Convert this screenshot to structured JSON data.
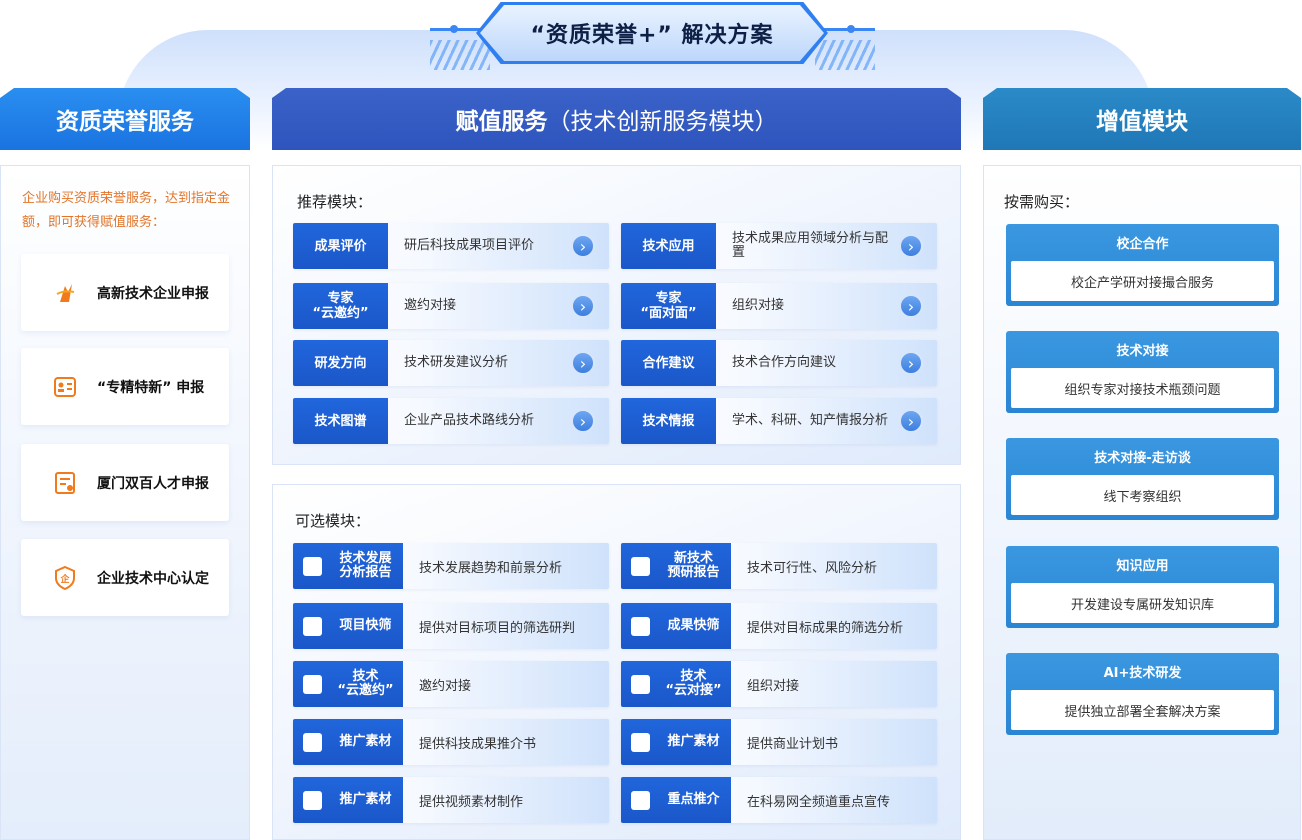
{
  "title": "“资质荣誉+” 解决方案",
  "columns": {
    "left": {
      "header": "资质荣誉服务",
      "intro": "企业购买资质荣誉服务，达到指定金额，即可获得赋值服务：",
      "items": [
        {
          "label": "高新技术企业申报",
          "icon": "torch-icon"
        },
        {
          "label": "“专精特新” 申报",
          "icon": "id-card-icon"
        },
        {
          "label": "厦门双百人才申报",
          "icon": "talent-certificate-icon"
        },
        {
          "label": "企业技术中心认定",
          "icon": "enterprise-shield-icon"
        }
      ]
    },
    "middle": {
      "header": "赋值服务",
      "header_sub": "（技术创新服务模块）",
      "recommended_label": "推荐模块：",
      "recommended": [
        {
          "tag": "成果评价",
          "desc": "研后科技成果项目评价"
        },
        {
          "tag": "技术应用",
          "desc": "技术成果应用领域分析与配置"
        },
        {
          "tag": "专家\n“云邀约”",
          "desc": "邀约对接"
        },
        {
          "tag": "专家\n“面对面”",
          "desc": "组织对接"
        },
        {
          "tag": "研发方向",
          "desc": "技术研发建议分析"
        },
        {
          "tag": "合作建议",
          "desc": "技术合作方向建议"
        },
        {
          "tag": "技术图谱",
          "desc": "企业产品技术路线分析"
        },
        {
          "tag": "技术情报",
          "desc": "学术、科研、知产情报分析"
        }
      ],
      "optional_label": "可选模块：",
      "optional": [
        {
          "tag": "技术发展\n分析报告",
          "desc": "技术发展趋势和前景分析"
        },
        {
          "tag": "新技术\n预研报告",
          "desc": "技术可行性、风险分析"
        },
        {
          "tag": "项目快筛",
          "desc": "提供对目标项目的筛选研判"
        },
        {
          "tag": "成果快筛",
          "desc": "提供对目标成果的筛选分析"
        },
        {
          "tag": "技术\n“云邀约”",
          "desc": "邀约对接"
        },
        {
          "tag": "技术\n“云对接”",
          "desc": "组织对接"
        },
        {
          "tag": "推广素材",
          "desc": "提供科技成果推介书"
        },
        {
          "tag": "推广素材",
          "desc": "提供商业计划书"
        },
        {
          "tag": "推广素材",
          "desc": "提供视频素材制作"
        },
        {
          "tag": "重点推介",
          "desc": "在科易网全频道重点宣传"
        }
      ]
    },
    "right": {
      "header": "增值模块",
      "label": "按需购买：",
      "items": [
        {
          "title": "校企合作",
          "desc": "校企产学研对接撮合服务"
        },
        {
          "title": "技术对接",
          "desc": "组织专家对接技术瓶颈问题"
        },
        {
          "title": "技术对接-走访谈",
          "desc": "线下考察组织"
        },
        {
          "title": "知识应用",
          "desc": "开发建设专属研发知识库"
        },
        {
          "title": "AI+技术研发",
          "desc": "提供独立部署全套解决方案"
        }
      ]
    }
  },
  "colors": {
    "accent_blue": "#1a57c9",
    "orange": "#e2752a",
    "teal": "#2a86d4"
  }
}
